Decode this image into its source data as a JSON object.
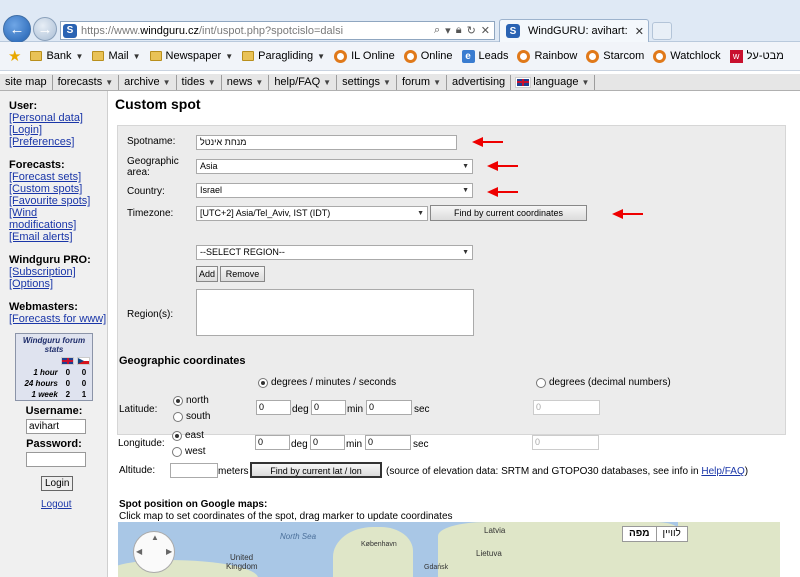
{
  "browser": {
    "url_prefix": "https://www.",
    "url_domain": "windguru.cz",
    "url_suffix": "/int/uspot.php?spotcislo=dalsi",
    "tab_title": "WindGURU: avihart: Custo...",
    "favorites": [
      {
        "label": "Bank",
        "icon": "folder-icon",
        "dropdown": true
      },
      {
        "label": "Mail",
        "icon": "folder-icon",
        "dropdown": true
      },
      {
        "label": "Newspaper",
        "icon": "folder-icon",
        "dropdown": true
      },
      {
        "label": "Paragliding",
        "icon": "folder-icon",
        "dropdown": true
      },
      {
        "label": "IL Online",
        "icon": "orange-circle-icon",
        "dropdown": false
      },
      {
        "label": "Online",
        "icon": "orange-circle-icon",
        "dropdown": false
      },
      {
        "label": "Leads",
        "icon": "ie-icon",
        "dropdown": false
      },
      {
        "label": "Rainbow",
        "icon": "orange-circle-icon",
        "dropdown": false
      },
      {
        "label": "Starcom",
        "icon": "orange-circle-icon",
        "dropdown": false
      },
      {
        "label": "Watchlock",
        "icon": "orange-circle-icon",
        "dropdown": false
      },
      {
        "label": "מבט-על",
        "icon": "walla-icon",
        "dropdown": false
      }
    ]
  },
  "menu": [
    {
      "label": "site map",
      "dropdown": false
    },
    {
      "label": "forecasts",
      "dropdown": true
    },
    {
      "label": "archive",
      "dropdown": true
    },
    {
      "label": "tides",
      "dropdown": true
    },
    {
      "label": "news",
      "dropdown": true
    },
    {
      "label": "help/FAQ",
      "dropdown": true
    },
    {
      "label": "settings",
      "dropdown": true
    },
    {
      "label": "forum",
      "dropdown": true
    },
    {
      "label": "advertising",
      "dropdown": false
    },
    {
      "label": "language",
      "dropdown": true
    }
  ],
  "sidebar": {
    "user_head": "User:",
    "user_links": [
      "[Personal data]",
      "[Login]",
      "[Preferences]"
    ],
    "forecasts_head": "Forecasts:",
    "forecasts_links": [
      "[Forecast sets]",
      "[Custom spots]",
      "[Favourite spots]",
      "[Wind modifications]",
      "[Email alerts]"
    ],
    "pro_head": "Windguru PRO:",
    "pro_links": [
      "[Subscription]",
      "[Options]"
    ],
    "webmasters_head": "Webmasters:",
    "webmasters_links": [
      "[Forecasts for www]"
    ],
    "stats": {
      "title": "Windguru forum stats",
      "rows": [
        {
          "label": "1 hour",
          "uk": "0",
          "cz": "0"
        },
        {
          "label": "24 hours",
          "uk": "0",
          "cz": "0"
        },
        {
          "label": "1 week",
          "uk": "2",
          "cz": "1"
        }
      ]
    },
    "username_label": "Username:",
    "username_value": "avihart",
    "password_label": "Password:",
    "login_button": "Login",
    "logout_link": "Logout"
  },
  "page": {
    "title": "Custom spot",
    "spotname_label": "Spotname:",
    "spotname_value": "מנחת אינטל",
    "area_label_1": "Geographic",
    "area_label_2": "area:",
    "area_value": "Asia",
    "country_label": "Country:",
    "country_value": "Israel",
    "timezone_label": "Timezone:",
    "timezone_value": "[UTC+2] Asia/Tel_Aviv, IST (IDT)",
    "find_coords_button": "Find by current coordinates",
    "region_select": "--SELECT REGION--",
    "add_button": "Add",
    "remove_button": "Remove",
    "regions_label": "Region(s):",
    "coords_title": "Geographic coordinates",
    "dms_option": "degrees / minutes / seconds",
    "decimal_option": "degrees (decimal numbers)",
    "latitude_label": "Latitude:",
    "north": "north",
    "south": "south",
    "longitude_label": "Longitude:",
    "east": "east",
    "west": "west",
    "lat_deg": "0",
    "lat_min": "0",
    "lat_sec": "0",
    "lon_deg": "0",
    "lon_min": "0",
    "lon_sec": "0",
    "deg_unit": "deg",
    "min_unit": "min",
    "sec_unit": "sec",
    "lat_decimal": "0",
    "lon_decimal": "0",
    "altitude_label": "Altitude:",
    "altitude_value": "",
    "meters_unit": "meters",
    "find_latlon_button": "Find by current lat / lon",
    "elevation_note": "(source of elevation data: SRTM and GTOPO30 databases, see info in",
    "help_link": "Help/FAQ",
    "close_paren": ")",
    "map_title": "Spot position on Google maps:",
    "map_subtitle": "Click map to set coordinates of the spot, drag marker to update coordinates",
    "map_type_map": "מפה",
    "map_type_sat": "לוויין",
    "map_labels": {
      "north_sea": "North Sea",
      "latvia": "Latvia",
      "kobenhavn": "København",
      "lietuva": "Lietuva",
      "united": "United",
      "kingdom": "Kingdom",
      "gdansk": "Gdańsk"
    }
  },
  "colors": {
    "arrow": "#ee0000",
    "link": "#1a36a8"
  }
}
